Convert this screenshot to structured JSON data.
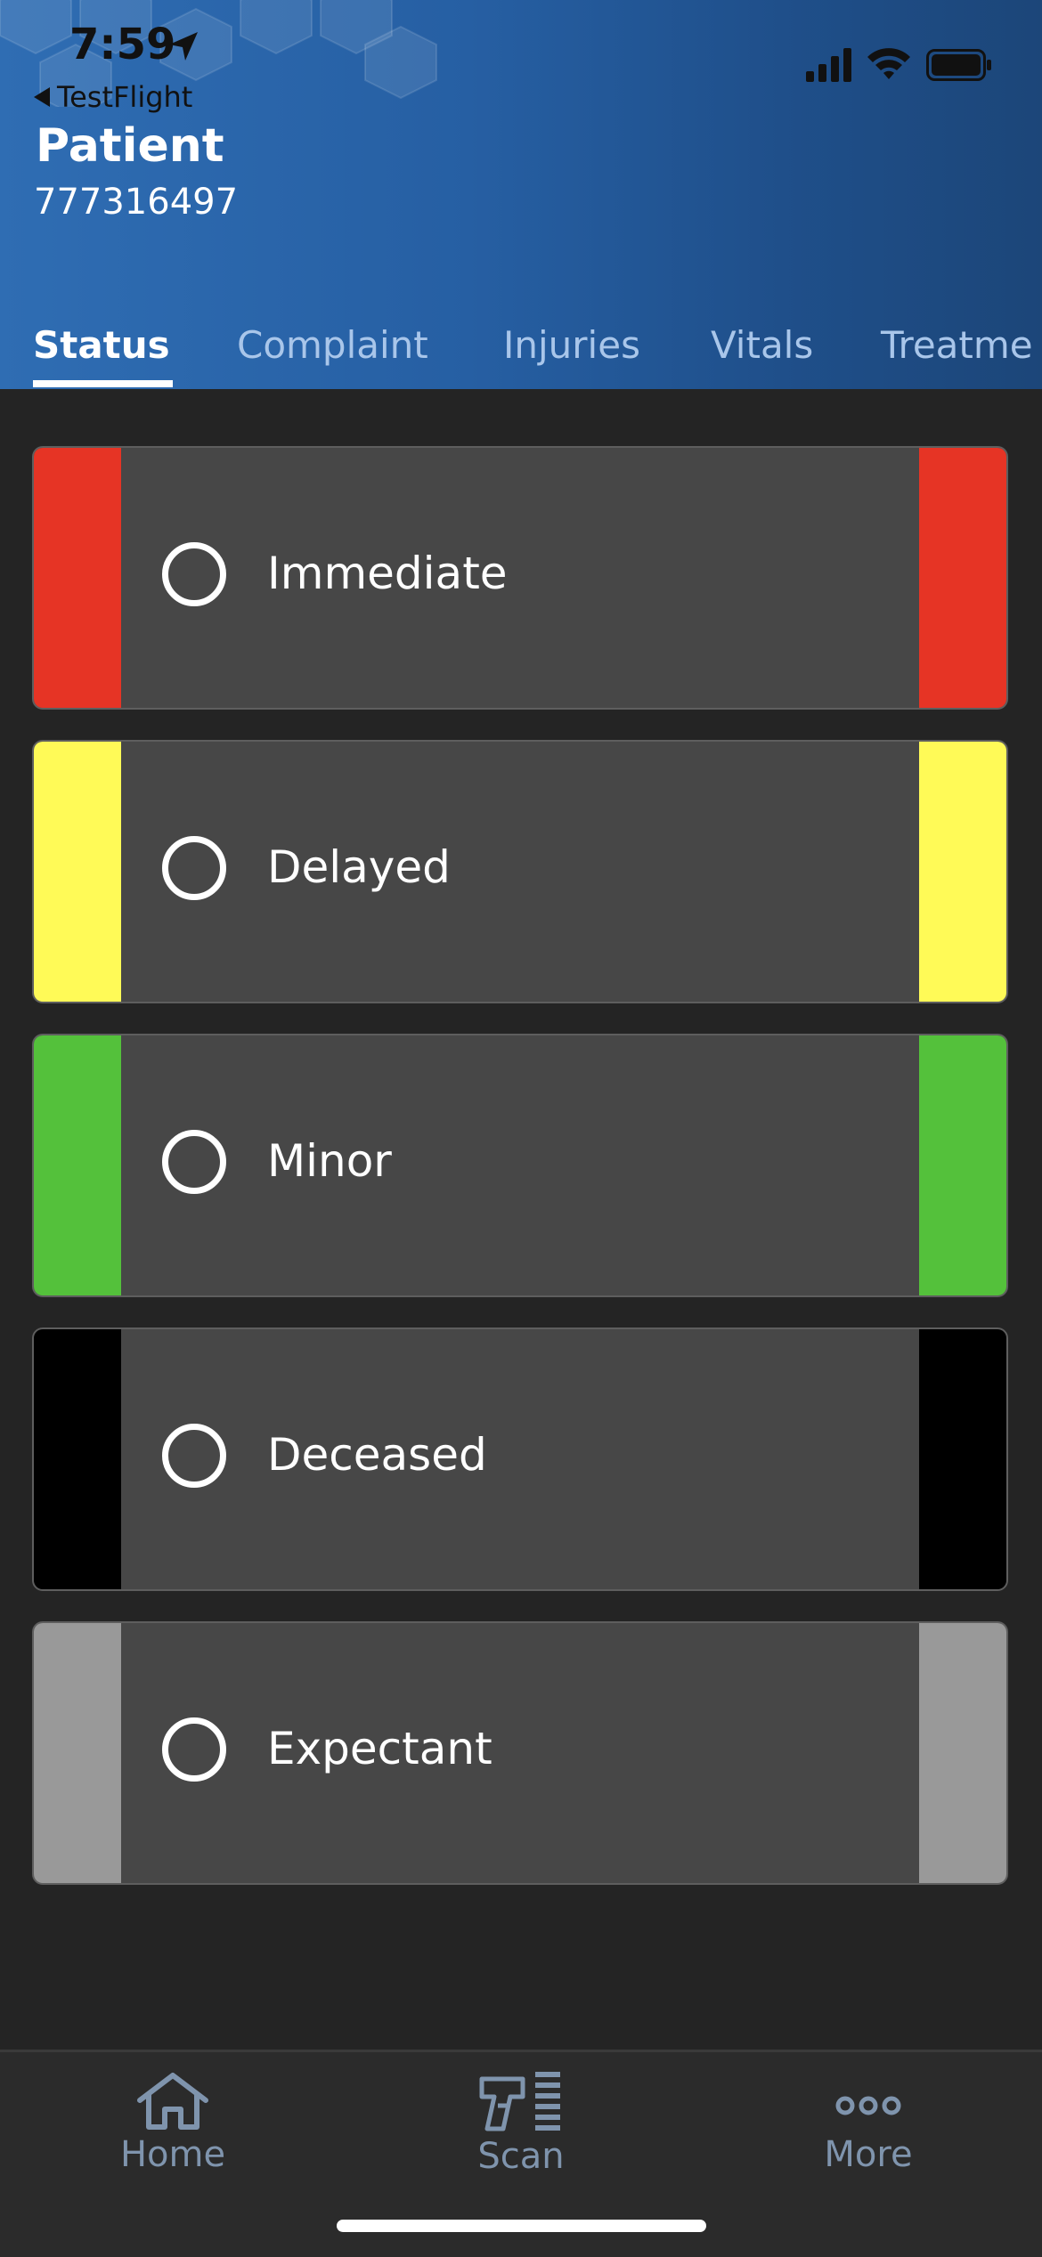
{
  "status_bar": {
    "time": "7:59",
    "back_label": "TestFlight"
  },
  "header": {
    "title": "Patient",
    "patient_id": "777316497"
  },
  "tabs": [
    {
      "label": "Status",
      "active": true
    },
    {
      "label": "Complaint",
      "active": false
    },
    {
      "label": "Injuries",
      "active": false
    },
    {
      "label": "Vitals",
      "active": false
    },
    {
      "label": "Treatme",
      "active": false
    }
  ],
  "statuses": [
    {
      "label": "Immediate",
      "color": "#e63425",
      "selected": false
    },
    {
      "label": "Delayed",
      "color": "#fffa57",
      "selected": false
    },
    {
      "label": "Minor",
      "color": "#54c13b",
      "selected": false
    },
    {
      "label": "Deceased",
      "color": "#000000",
      "selected": false
    },
    {
      "label": "Expectant",
      "color": "#999999",
      "selected": false
    }
  ],
  "bottom_nav": [
    {
      "label": "Home",
      "icon": "home-icon"
    },
    {
      "label": "Scan",
      "icon": "scanner-icon"
    },
    {
      "label": "More",
      "icon": "more-icon"
    }
  ],
  "colors": {
    "header_gradient_start": "#2f6db3",
    "header_gradient_end": "#1c4679",
    "background": "#242424",
    "card_background": "#474747",
    "nav_inactive": "#7f94ad",
    "tab_inactive": "#a9c6ea"
  }
}
